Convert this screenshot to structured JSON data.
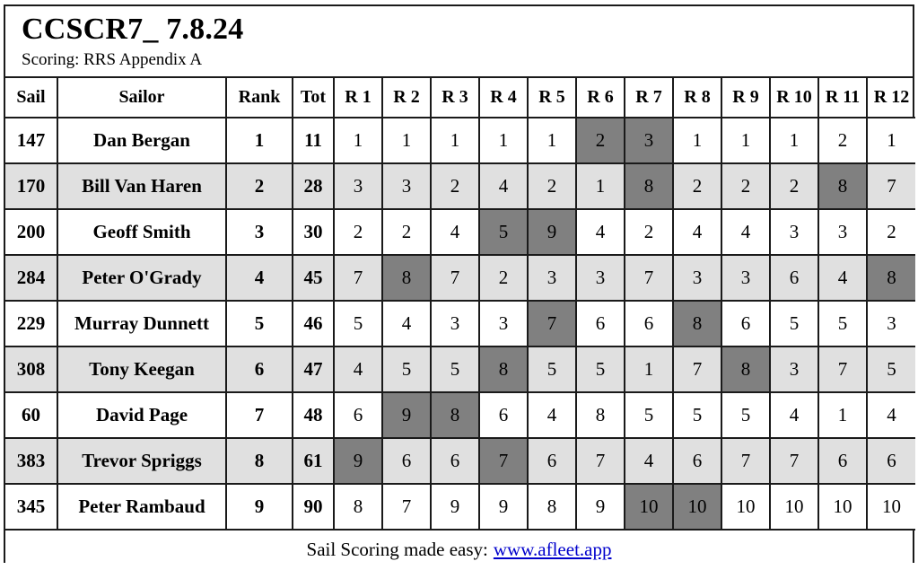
{
  "header": {
    "event_title": "CCSCR7_ 7.8.24",
    "scoring_line": "Scoring: RRS Appendix A"
  },
  "table": {
    "columns": [
      {
        "key": "sail",
        "label": "Sail"
      },
      {
        "key": "sailor",
        "label": "Sailor"
      },
      {
        "key": "rank",
        "label": "Rank"
      },
      {
        "key": "tot",
        "label": "Tot"
      },
      {
        "key": "r1",
        "label": "R 1"
      },
      {
        "key": "r2",
        "label": "R 2"
      },
      {
        "key": "r3",
        "label": "R 3"
      },
      {
        "key": "r4",
        "label": "R 4"
      },
      {
        "key": "r5",
        "label": "R 5"
      },
      {
        "key": "r6",
        "label": "R 6"
      },
      {
        "key": "r7",
        "label": "R 7"
      },
      {
        "key": "r8",
        "label": "R 8"
      },
      {
        "key": "r9",
        "label": "R 9"
      },
      {
        "key": "r10",
        "label": "R 10"
      },
      {
        "key": "r11",
        "label": "R 11"
      },
      {
        "key": "r12",
        "label": "R 12"
      }
    ],
    "rows": [
      {
        "sail": "147",
        "sailor": "Dan Bergan",
        "rank": "1",
        "tot": "11",
        "races": [
          "1",
          "1",
          "1",
          "1",
          "1",
          "2",
          "3",
          "1",
          "1",
          "1",
          "2",
          "1"
        ],
        "discards": [
          5,
          6
        ]
      },
      {
        "sail": "170",
        "sailor": "Bill Van Haren",
        "rank": "2",
        "tot": "28",
        "races": [
          "3",
          "3",
          "2",
          "4",
          "2",
          "1",
          "8",
          "2",
          "2",
          "2",
          "8",
          "7"
        ],
        "discards": [
          6,
          10
        ]
      },
      {
        "sail": "200",
        "sailor": "Geoff Smith",
        "rank": "3",
        "tot": "30",
        "races": [
          "2",
          "2",
          "4",
          "5",
          "9",
          "4",
          "2",
          "4",
          "4",
          "3",
          "3",
          "2"
        ],
        "discards": [
          3,
          4
        ]
      },
      {
        "sail": "284",
        "sailor": "Peter O'Grady",
        "rank": "4",
        "tot": "45",
        "races": [
          "7",
          "8",
          "7",
          "2",
          "3",
          "3",
          "7",
          "3",
          "3",
          "6",
          "4",
          "8"
        ],
        "discards": [
          1,
          11
        ]
      },
      {
        "sail": "229",
        "sailor": "Murray Dunnett",
        "rank": "5",
        "tot": "46",
        "races": [
          "5",
          "4",
          "3",
          "3",
          "7",
          "6",
          "6",
          "8",
          "6",
          "5",
          "5",
          "3"
        ],
        "discards": [
          4,
          7
        ]
      },
      {
        "sail": "308",
        "sailor": "Tony Keegan",
        "rank": "6",
        "tot": "47",
        "races": [
          "4",
          "5",
          "5",
          "8",
          "5",
          "5",
          "1",
          "7",
          "8",
          "3",
          "7",
          "5"
        ],
        "discards": [
          3,
          8
        ]
      },
      {
        "sail": "60",
        "sailor": "David Page",
        "rank": "7",
        "tot": "48",
        "races": [
          "6",
          "9",
          "8",
          "6",
          "4",
          "8",
          "5",
          "5",
          "5",
          "4",
          "1",
          "4"
        ],
        "discards": [
          1,
          2
        ]
      },
      {
        "sail": "383",
        "sailor": "Trevor Spriggs",
        "rank": "8",
        "tot": "61",
        "races": [
          "9",
          "6",
          "6",
          "7",
          "6",
          "7",
          "4",
          "6",
          "7",
          "7",
          "6",
          "6"
        ],
        "discards": [
          0,
          3
        ]
      },
      {
        "sail": "345",
        "sailor": "Peter Rambaud",
        "rank": "9",
        "tot": "90",
        "races": [
          "8",
          "7",
          "9",
          "9",
          "8",
          "9",
          "10",
          "10",
          "10",
          "10",
          "10",
          "10"
        ],
        "discards": [
          6,
          7
        ]
      }
    ]
  },
  "footer": {
    "text": "Sail Scoring made easy:",
    "link_label": "www.afleet.app"
  },
  "colors": {
    "discard_bg": "#808080",
    "discard_fg": "#ffffff",
    "stripe_bg": "#e0e0e0",
    "row_bg": "#ffffff",
    "border": "#1a1a1a",
    "link": "#0000cc"
  }
}
